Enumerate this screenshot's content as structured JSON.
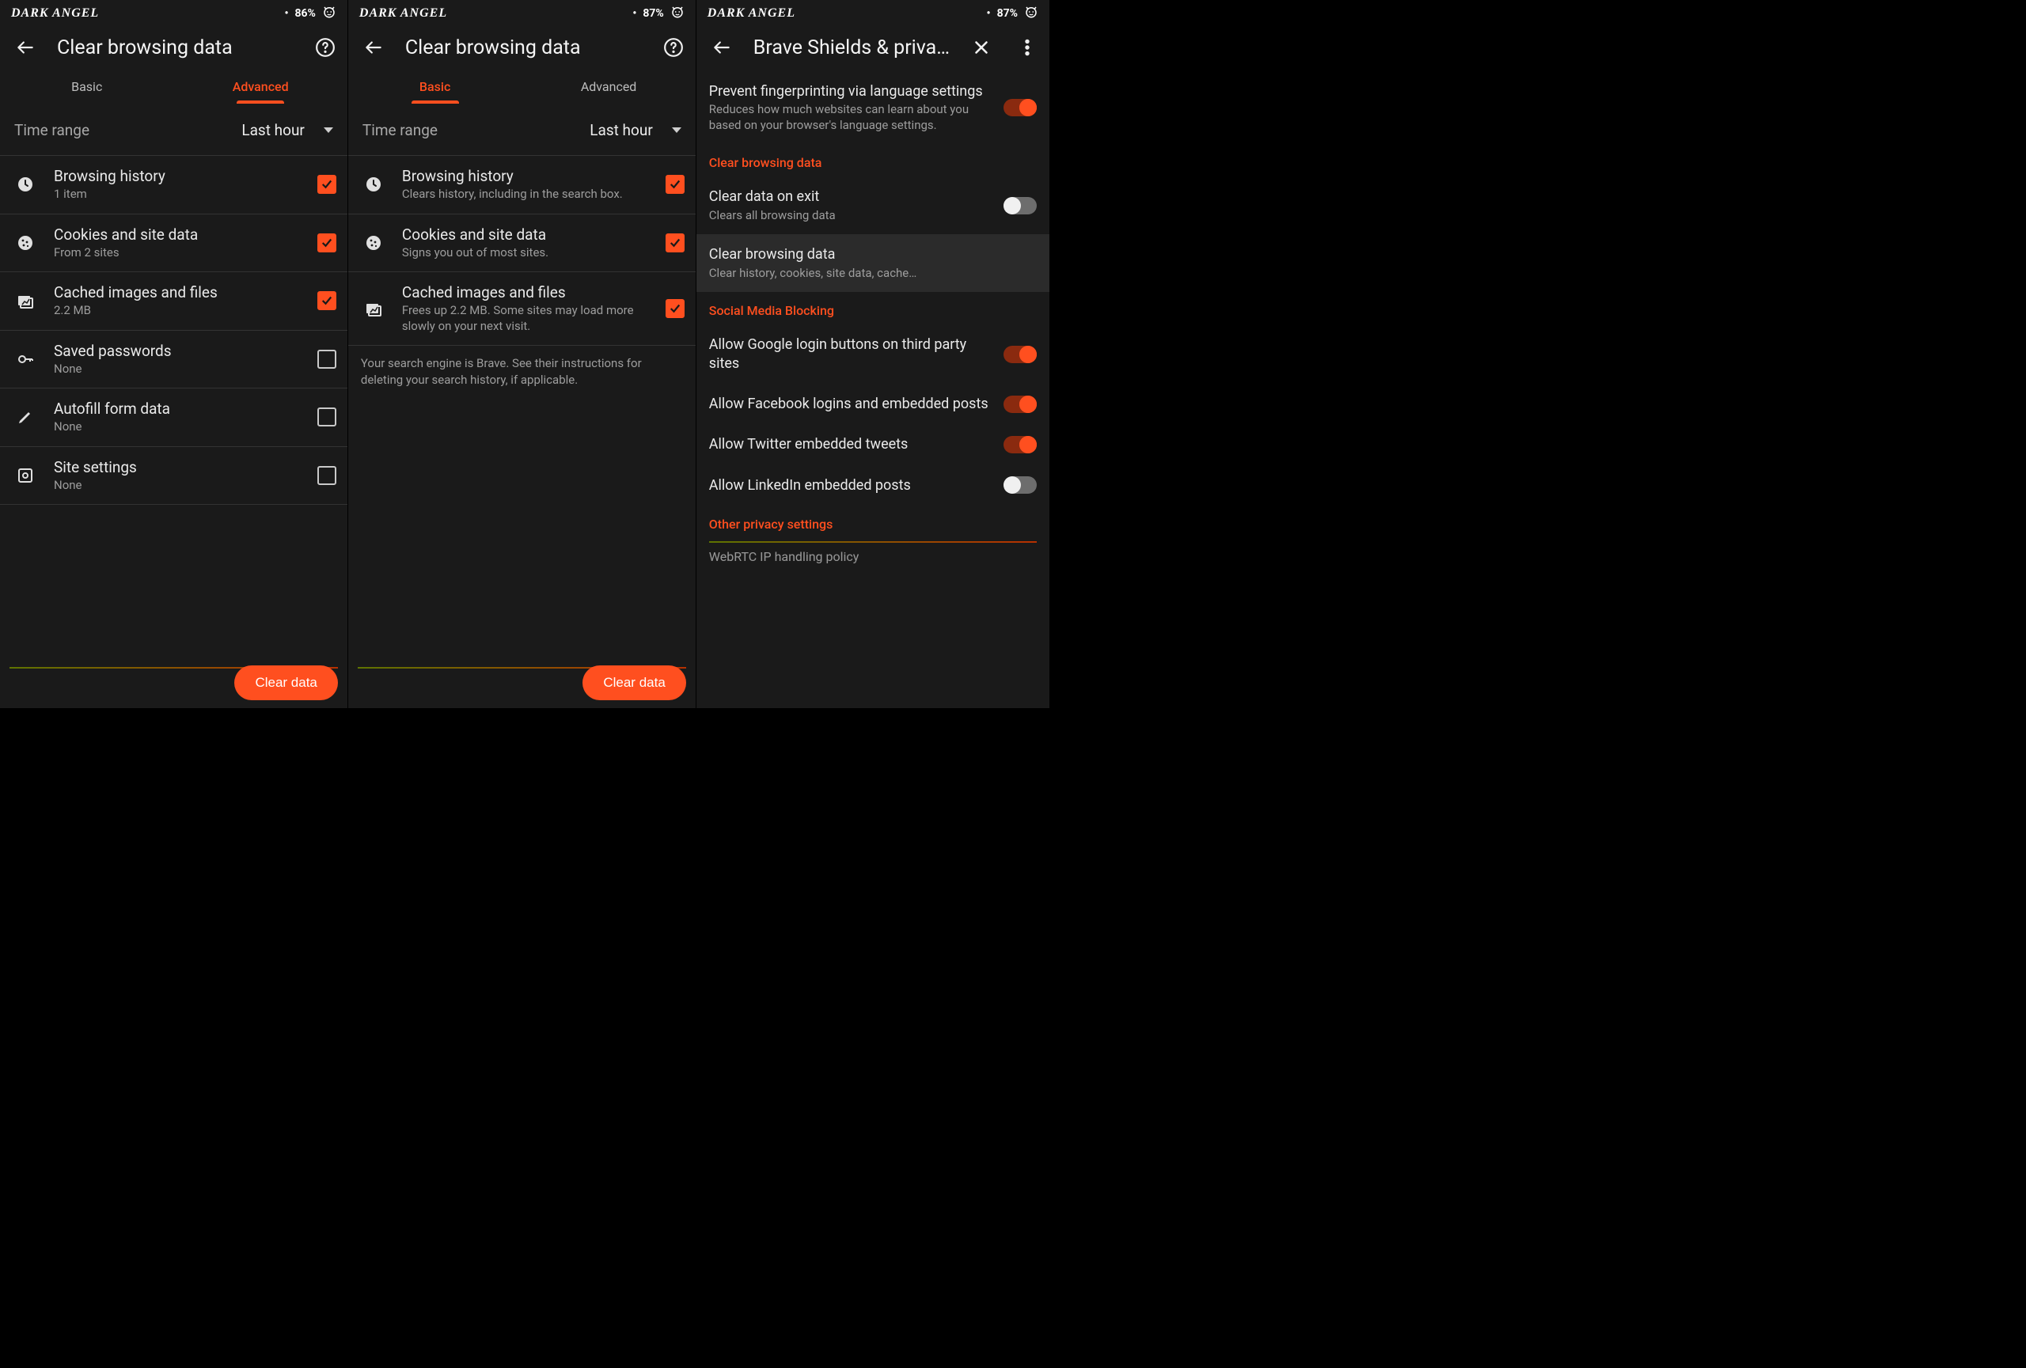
{
  "status": {
    "carrier": "DARK ANGEL",
    "battery_p1": "86%",
    "battery_p2": "87%",
    "battery_p3": "87%"
  },
  "panel1": {
    "title": "Clear browsing data",
    "tabs": {
      "basic": "Basic",
      "advanced": "Advanced"
    },
    "active_tab": "advanced",
    "time_range_label": "Time range",
    "time_range_value": "Last hour",
    "items": [
      {
        "icon": "clock-icon",
        "title": "Browsing history",
        "sub": "1 item",
        "checked": true
      },
      {
        "icon": "cookie-icon",
        "title": "Cookies and site data",
        "sub": "From 2 sites",
        "checked": true
      },
      {
        "icon": "image-icon",
        "title": "Cached images and files",
        "sub": "2.2 MB",
        "checked": true
      },
      {
        "icon": "key-icon",
        "title": "Saved passwords",
        "sub": "None",
        "checked": false
      },
      {
        "icon": "pencil-icon",
        "title": "Autofill form data",
        "sub": "None",
        "checked": false
      },
      {
        "icon": "settings-box-icon",
        "title": "Site settings",
        "sub": "None",
        "checked": false
      }
    ],
    "clear_button": "Clear data"
  },
  "panel2": {
    "title": "Clear browsing data",
    "tabs": {
      "basic": "Basic",
      "advanced": "Advanced"
    },
    "active_tab": "basic",
    "time_range_label": "Time range",
    "time_range_value": "Last hour",
    "items": [
      {
        "icon": "clock-icon",
        "title": "Browsing history",
        "sub": "Clears history, including in the search box.",
        "checked": true
      },
      {
        "icon": "cookie-icon",
        "title": "Cookies and site data",
        "sub": "Signs you out of most sites.",
        "checked": true
      },
      {
        "icon": "image-icon",
        "title": "Cached images and files",
        "sub": "Frees up 2.2 MB. Some sites may load more slowly on your next visit.",
        "checked": true
      }
    ],
    "footer_note": "Your search engine is Brave. See their instructions for deleting your search history, if applicable.",
    "clear_button": "Clear data"
  },
  "panel3": {
    "title": "Brave Shields & priva…",
    "rows": [
      {
        "type": "setting",
        "title": "Prevent fingerprinting via language settings",
        "sub": "Reduces how much websites can learn about you based on your browser's language settings.",
        "toggle": true
      },
      {
        "type": "header",
        "title": "Clear browsing data"
      },
      {
        "type": "setting",
        "title": "Clear data on exit",
        "sub": "Clears all browsing data",
        "toggle": false
      },
      {
        "type": "setting-hl",
        "title": "Clear browsing data",
        "sub": "Clear history, cookies, site data, cache…"
      },
      {
        "type": "header",
        "title": "Social Media Blocking"
      },
      {
        "type": "setting",
        "title": "Allow Google login buttons on third party sites",
        "toggle": true
      },
      {
        "type": "setting",
        "title": "Allow Facebook logins and embedded posts",
        "toggle": true
      },
      {
        "type": "setting",
        "title": "Allow Twitter embedded tweets",
        "toggle": true
      },
      {
        "type": "setting",
        "title": "Allow LinkedIn embedded posts",
        "toggle": false
      },
      {
        "type": "header",
        "title": "Other privacy settings"
      },
      {
        "type": "divider"
      },
      {
        "type": "setting-cut",
        "title": "WebRTC IP handling policy"
      }
    ]
  }
}
